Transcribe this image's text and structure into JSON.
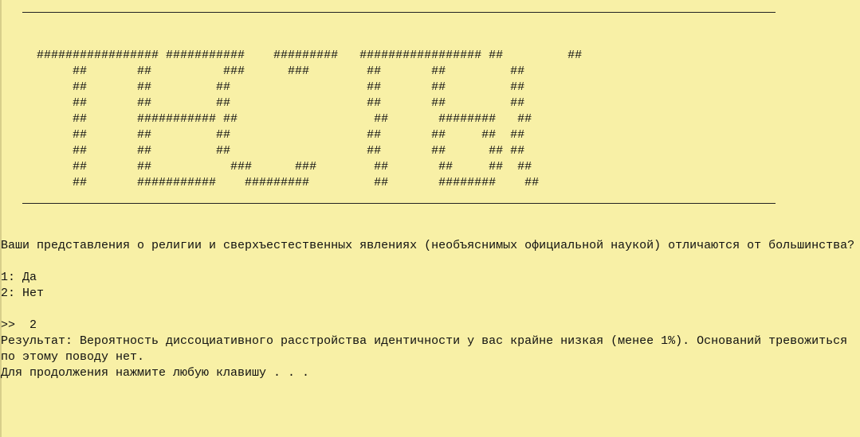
{
  "banner": {
    "lines": [
      "     ################# ###########    #########   ################# ##         ##",
      "          ##       ##          ###      ###        ##       ##         ##",
      "          ##       ##         ##                   ##       ##         ##",
      "          ##       ##         ##                   ##       ##         ##",
      "          ##       ########### ##                   ##       ########   ##",
      "          ##       ##         ##                   ##       ##     ##  ##",
      "          ##       ##         ##                   ##       ##      ## ##",
      "          ##       ##           ###      ###        ##       ##     ##  ##",
      "          ##       ###########    #########         ##       ########    ##"
    ]
  },
  "question": {
    "text": "Ваши представления о религии и сверхъестественных явлениях (необъяснимых официальной наукой) отличаются от большинства?"
  },
  "options": [
    {
      "text": "1: Да"
    },
    {
      "text": "2: Нет"
    }
  ],
  "prompt": {
    "text": ">>  2"
  },
  "result": {
    "line1": "Результат: Вероятность диссоциативного расстройства идентичности у вас крайне низкая (менее 1%). Оснований тревожиться",
    "line2": "по этому поводу нет."
  },
  "continue": {
    "text": "Для продолжения нажмите любую клавишу . . ."
  },
  "colors": {
    "background": "#f8f0a6",
    "text": "#111111"
  }
}
